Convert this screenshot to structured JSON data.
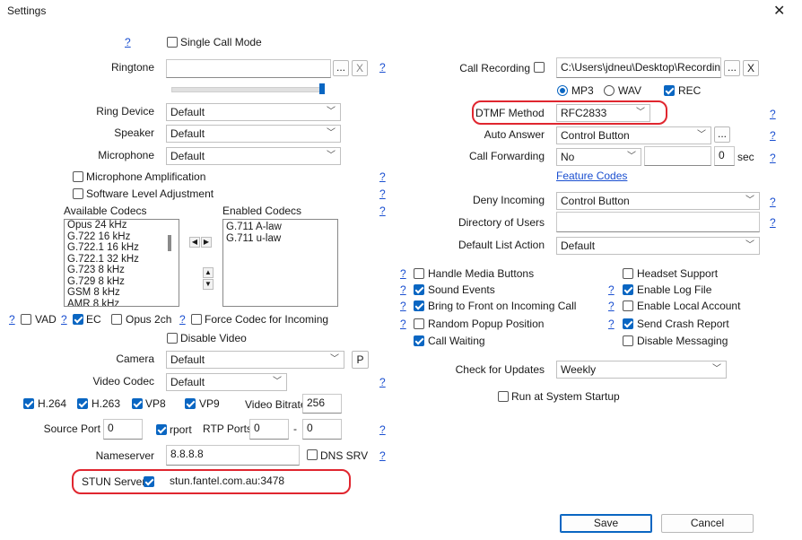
{
  "window": {
    "title": "Settings",
    "close_glyph": "✕"
  },
  "help_glyph": "?",
  "left": {
    "single_call_mode": {
      "label": "Single Call Mode",
      "checked": false
    },
    "ringtone": {
      "label": "Ringtone",
      "value": "",
      "browse": "...",
      "clear": "X"
    },
    "ring_device": {
      "label": "Ring Device",
      "value": "Default"
    },
    "speaker": {
      "label": "Speaker",
      "value": "Default"
    },
    "microphone": {
      "label": "Microphone",
      "value": "Default"
    },
    "mic_amplification": {
      "label": "Microphone Amplification",
      "checked": false
    },
    "software_level": {
      "label": "Software Level Adjustment",
      "checked": false
    },
    "available_codecs": {
      "label": "Available Codecs",
      "items": [
        "Opus 24 kHz",
        "G.722 16 kHz",
        "G.722.1 16 kHz",
        "G.722.1 32 kHz",
        "G.723 8 kHz",
        "G.729 8 kHz",
        "GSM 8 kHz",
        "AMR 8 kHz"
      ]
    },
    "enabled_codecs": {
      "label": "Enabled Codecs",
      "items": [
        "G.711 A-law",
        "G.711 u-law"
      ]
    },
    "vad": {
      "label": "VAD",
      "checked": false
    },
    "ec": {
      "label": "EC",
      "checked": true
    },
    "opus2ch": {
      "label": "Opus 2ch",
      "checked": false
    },
    "force_codec": {
      "label": "Force Codec for Incoming",
      "checked": false
    },
    "disable_video": {
      "label": "Disable Video",
      "checked": false
    },
    "camera": {
      "label": "Camera",
      "value": "Default",
      "preview": "P"
    },
    "video_codec": {
      "label": "Video Codec",
      "value": "Default"
    },
    "h264": {
      "label": "H.264",
      "checked": true
    },
    "h263": {
      "label": "H.263",
      "checked": true
    },
    "vp8": {
      "label": "VP8",
      "checked": true
    },
    "vp9": {
      "label": "VP9",
      "checked": true
    },
    "video_bitrate": {
      "label": "Video Bitrate",
      "value": "256"
    },
    "source_port": {
      "label": "Source Port",
      "value": "0"
    },
    "rport": {
      "label": "rport",
      "checked": true
    },
    "rtp_ports": {
      "label": "RTP Ports",
      "from": "0",
      "sep": "-",
      "to": "0"
    },
    "nameserver": {
      "label": "Nameserver",
      "value": "8.8.8.8"
    },
    "dns_srv": {
      "label": "DNS SRV",
      "checked": false
    },
    "stun_server": {
      "label": "STUN Server",
      "checked": true,
      "value": "stun.fantel.com.au:3478"
    }
  },
  "right": {
    "call_recording": {
      "label": "Call Recording",
      "checked": false,
      "path": "C:\\Users\\jdneu\\Desktop\\Recordings",
      "browse": "...",
      "clear": "X"
    },
    "rec_format": {
      "mp3": "MP3",
      "wav": "WAV",
      "selected": "MP3",
      "rec": "REC",
      "rec_checked": true
    },
    "dtmf_method": {
      "label": "DTMF Method",
      "value": "RFC2833"
    },
    "auto_answer": {
      "label": "Auto Answer",
      "value": "Control Button",
      "more": "..."
    },
    "call_forwarding": {
      "label": "Call Forwarding",
      "value": "No",
      "target": "",
      "delay": "0",
      "unit": "sec"
    },
    "feature_codes": "Feature Codes",
    "deny_incoming": {
      "label": "Deny Incoming",
      "value": "Control Button"
    },
    "directory_of_users": {
      "label": "Directory of Users",
      "value": ""
    },
    "default_list_action": {
      "label": "Default List Action",
      "value": "Default"
    },
    "checks_left": [
      {
        "label": "Handle Media Buttons",
        "checked": false
      },
      {
        "label": "Sound Events",
        "checked": true
      },
      {
        "label": "Bring to Front on Incoming Call",
        "checked": true
      },
      {
        "label": "Random Popup Position",
        "checked": false
      },
      {
        "label": "Call Waiting",
        "checked": true
      }
    ],
    "checks_right": [
      {
        "label": "Headset Support",
        "checked": false
      },
      {
        "label": "Enable Log File",
        "checked": true
      },
      {
        "label": "Enable Local Account",
        "checked": false
      },
      {
        "label": "Send Crash Report",
        "checked": true
      },
      {
        "label": "Disable Messaging",
        "checked": false
      }
    ],
    "check_for_updates": {
      "label": "Check for Updates",
      "value": "Weekly"
    },
    "run_at_startup": {
      "label": "Run at System Startup",
      "checked": false
    }
  },
  "footer": {
    "save": "Save",
    "cancel": "Cancel"
  },
  "colors": {
    "accent": "#0a66c2",
    "highlight_ring": "#e0262f",
    "link": "#1a4fd0"
  }
}
